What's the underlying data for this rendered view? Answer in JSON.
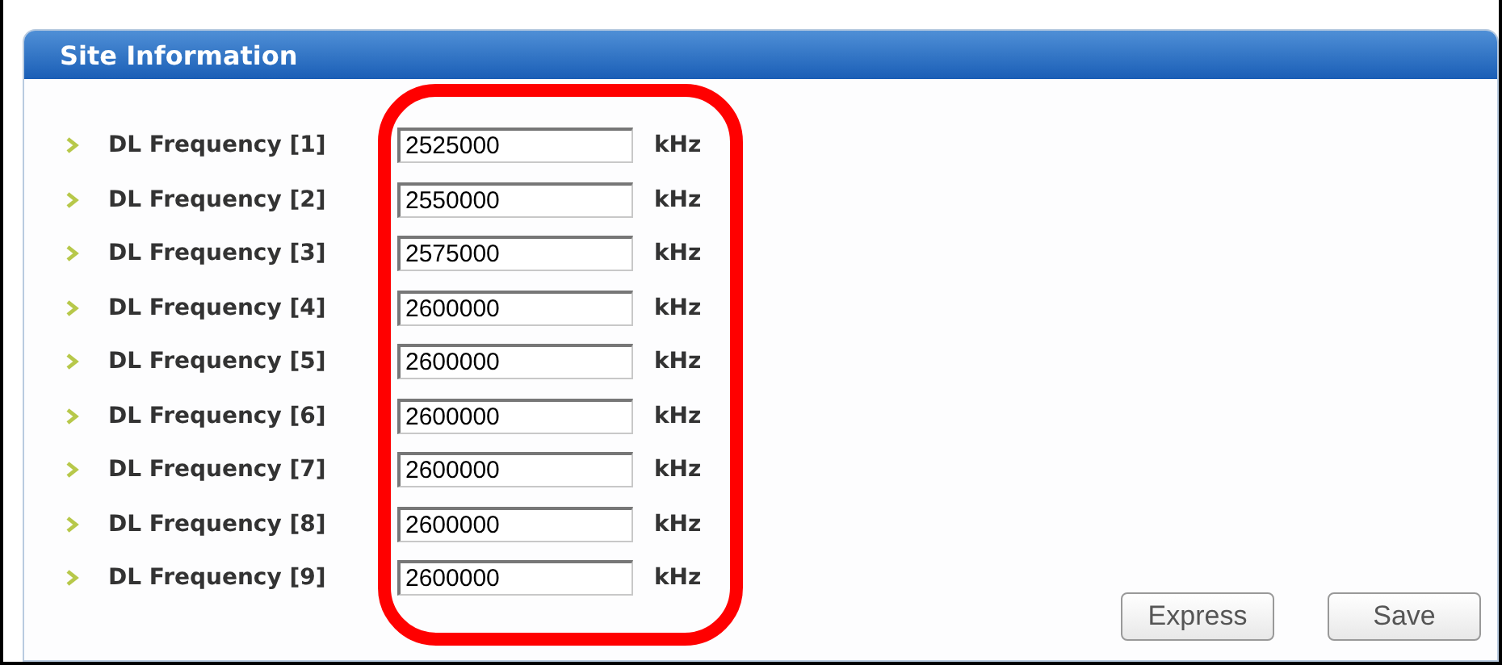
{
  "panel": {
    "title": "Site Information"
  },
  "fields": [
    {
      "label": "DL Frequency [1]",
      "value": "2525000",
      "unit": "kHz"
    },
    {
      "label": "DL Frequency [2]",
      "value": "2550000",
      "unit": "kHz"
    },
    {
      "label": "DL Frequency [3]",
      "value": "2575000",
      "unit": "kHz"
    },
    {
      "label": "DL Frequency [4]",
      "value": "2600000",
      "unit": "kHz"
    },
    {
      "label": "DL Frequency [5]",
      "value": "2600000",
      "unit": "kHz"
    },
    {
      "label": "DL Frequency [6]",
      "value": "2600000",
      "unit": "kHz"
    },
    {
      "label": "DL Frequency [7]",
      "value": "2600000",
      "unit": "kHz"
    },
    {
      "label": "DL Frequency [8]",
      "value": "2600000",
      "unit": "kHz"
    },
    {
      "label": "DL Frequency [9]",
      "value": "2600000",
      "unit": "kHz"
    }
  ],
  "buttons": [
    "Express",
    "Save"
  ]
}
